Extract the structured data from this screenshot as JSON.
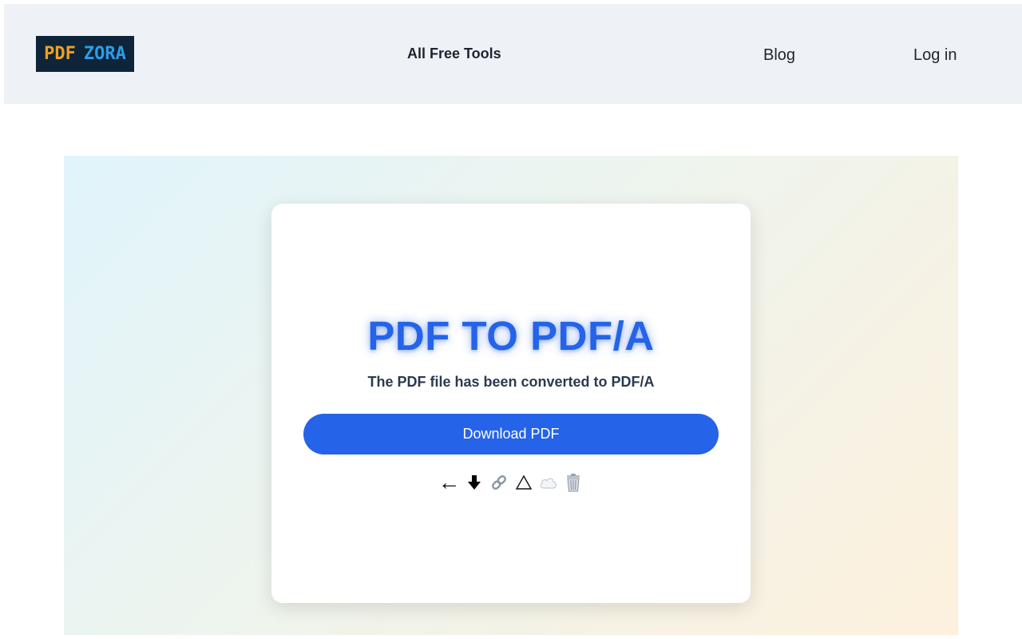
{
  "header": {
    "logo": {
      "left": "PDF",
      "right": "ZORA"
    },
    "nav": {
      "tools": "All Free Tools",
      "blog": "Blog",
      "login": "Log in"
    }
  },
  "card": {
    "title": "PDF TO PDF/A",
    "subtitle": "The PDF file has been converted to PDF/A",
    "download_label": "Download PDF",
    "actions": [
      {
        "icon": "back-arrow-icon"
      },
      {
        "icon": "download-icon"
      },
      {
        "icon": "link-icon"
      },
      {
        "icon": "drive-icon"
      },
      {
        "icon": "cloud-icon"
      },
      {
        "icon": "trash-icon"
      }
    ]
  },
  "colors": {
    "accent": "#2563e8",
    "header_bg": "#eef1f6",
    "logo_bg": "#0e2438",
    "logo_orange": "#f0a020",
    "logo_blue": "#2c9ee8"
  }
}
